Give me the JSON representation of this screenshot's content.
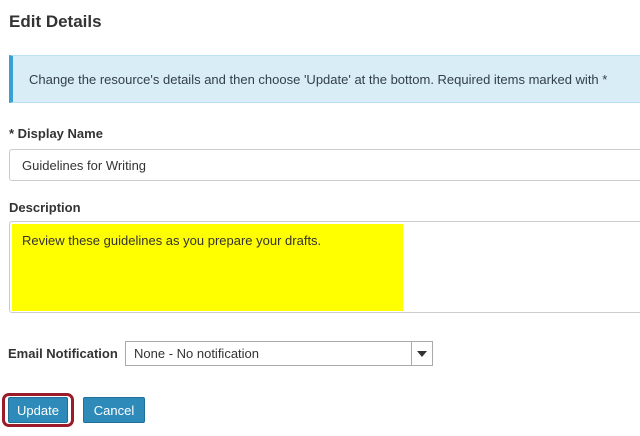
{
  "page": {
    "title": "Edit Details"
  },
  "info": {
    "message": "Change the resource's details and then choose 'Update' at the bottom. Required items marked with *"
  },
  "form": {
    "display_name_label": "* Display Name",
    "display_name_value": "Guidelines for Writing",
    "description_label": "Description",
    "description_value": "Review these guidelines as you prepare your drafts.",
    "email_notification_label": "Email Notification",
    "email_notification_selected": "None - No notification"
  },
  "buttons": {
    "update_label": "Update",
    "cancel_label": "Cancel"
  },
  "colors": {
    "info_background": "#d9edf7",
    "info_accent": "#3aa0d3",
    "highlight": "#ffff00",
    "button": "#2e8ab8",
    "focus_ring": "#9b1b2a"
  },
  "icons": {
    "select_arrow": "caret-down-icon"
  }
}
